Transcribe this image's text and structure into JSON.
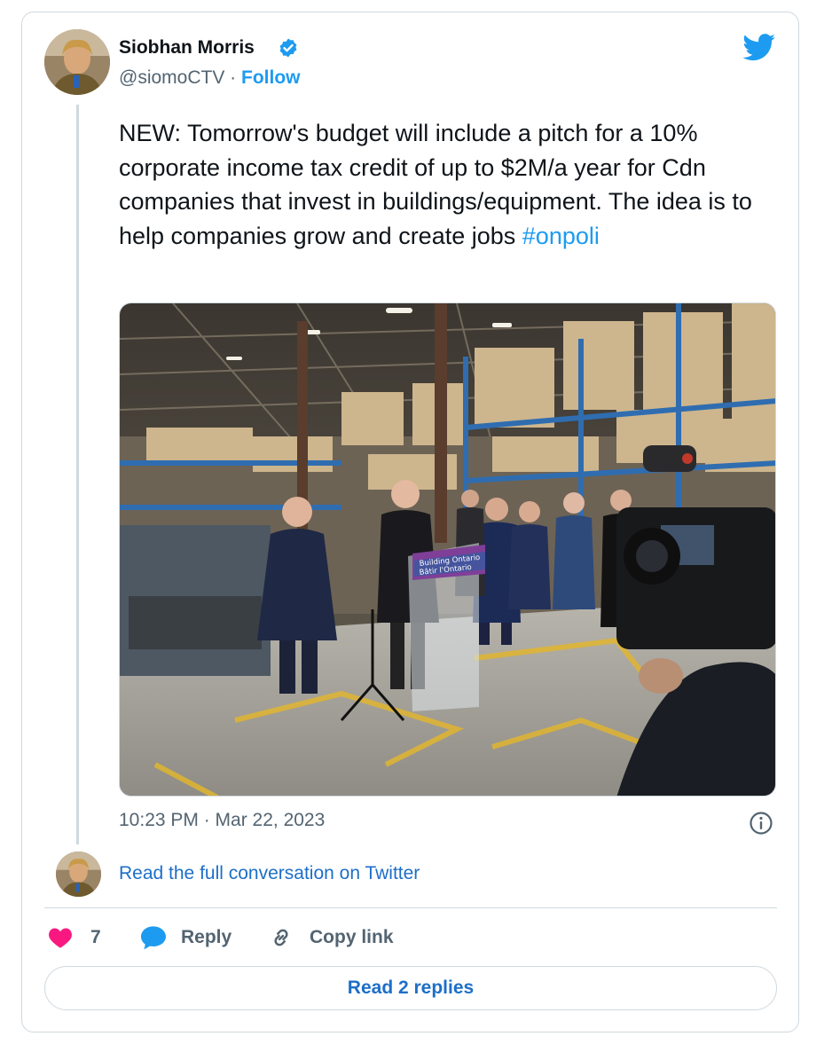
{
  "author": {
    "name": "Siobhan Morris",
    "handle": "@siomoCTV",
    "separator": " · ",
    "follow_label": "Follow"
  },
  "tweet": {
    "text": "NEW: Tomorrow's budget will include a pitch for a 10% corporate income tax credit of up to $2M/a year for Cdn companies that invest in buildings/equipment. The idea is to help companies grow and create jobs ",
    "hashtag": "#onpoli",
    "timestamp": "10:23 PM · Mar 22, 2023"
  },
  "photo": {
    "podium_sign_line1": "Building Ontario",
    "podium_sign_line2": "Bâtir l'Ontario"
  },
  "conversation_link": "Read the full conversation on Twitter",
  "actions": {
    "like_count": "7",
    "reply_label": "Reply",
    "copy_link_label": "Copy link"
  },
  "read_replies_label": "Read 2 replies",
  "icons": {
    "verified": "verified-badge-icon",
    "logo": "twitter-bird-icon",
    "info": "info-icon",
    "like": "heart-icon",
    "reply": "speech-bubble-icon",
    "link": "link-icon"
  },
  "colors": {
    "accent": "#1d9bf0",
    "link": "#1d6fc8",
    "heart": "#f91880",
    "muted": "#536471",
    "border": "#cfd9de"
  }
}
